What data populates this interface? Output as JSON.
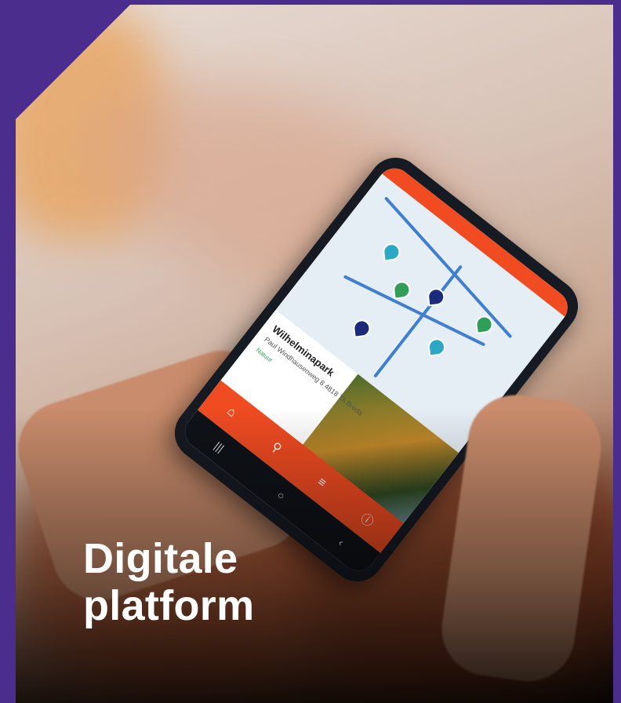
{
  "headline": {
    "line1": "Digitale",
    "line2": "platform"
  },
  "phone_screen": {
    "place_name": "Wilhelminapark",
    "address": "Paul Windhausenweg 8 4818 TA Breda",
    "tag": "Natuur"
  },
  "colors": {
    "frame": "#4a2d8c",
    "app_accent": "#f04b21",
    "headline_text": "#ffffff"
  },
  "icons": [
    "home-icon",
    "route-icon",
    "list-icon",
    "info-icon",
    "back-icon",
    "home-circle-icon",
    "recents-icon"
  ]
}
